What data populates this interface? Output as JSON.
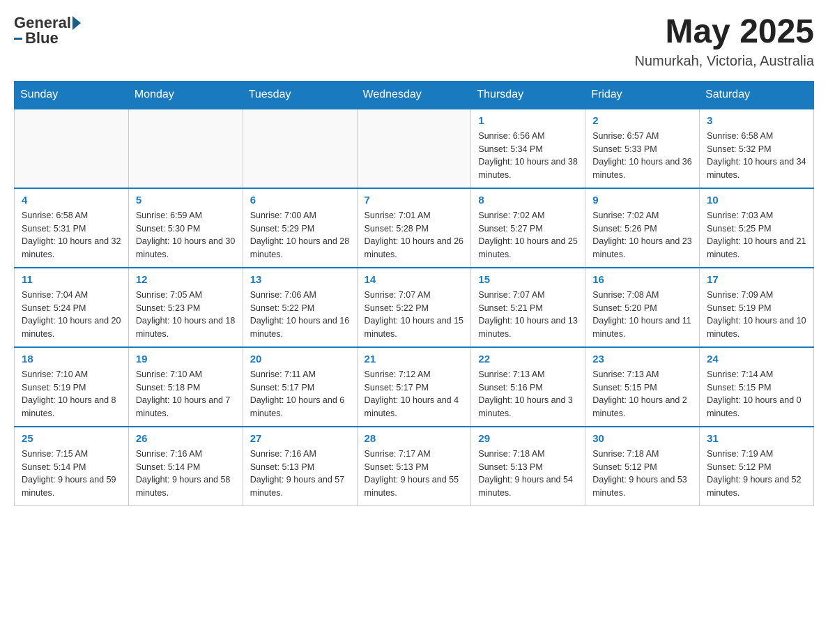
{
  "header": {
    "logo_general": "General",
    "logo_blue": "Blue",
    "month_title": "May 2025",
    "location": "Numurkah, Victoria, Australia"
  },
  "days_of_week": [
    "Sunday",
    "Monday",
    "Tuesday",
    "Wednesday",
    "Thursday",
    "Friday",
    "Saturday"
  ],
  "weeks": [
    [
      {
        "day": "",
        "info": ""
      },
      {
        "day": "",
        "info": ""
      },
      {
        "day": "",
        "info": ""
      },
      {
        "day": "",
        "info": ""
      },
      {
        "day": "1",
        "info": "Sunrise: 6:56 AM\nSunset: 5:34 PM\nDaylight: 10 hours and 38 minutes."
      },
      {
        "day": "2",
        "info": "Sunrise: 6:57 AM\nSunset: 5:33 PM\nDaylight: 10 hours and 36 minutes."
      },
      {
        "day": "3",
        "info": "Sunrise: 6:58 AM\nSunset: 5:32 PM\nDaylight: 10 hours and 34 minutes."
      }
    ],
    [
      {
        "day": "4",
        "info": "Sunrise: 6:58 AM\nSunset: 5:31 PM\nDaylight: 10 hours and 32 minutes."
      },
      {
        "day": "5",
        "info": "Sunrise: 6:59 AM\nSunset: 5:30 PM\nDaylight: 10 hours and 30 minutes."
      },
      {
        "day": "6",
        "info": "Sunrise: 7:00 AM\nSunset: 5:29 PM\nDaylight: 10 hours and 28 minutes."
      },
      {
        "day": "7",
        "info": "Sunrise: 7:01 AM\nSunset: 5:28 PM\nDaylight: 10 hours and 26 minutes."
      },
      {
        "day": "8",
        "info": "Sunrise: 7:02 AM\nSunset: 5:27 PM\nDaylight: 10 hours and 25 minutes."
      },
      {
        "day": "9",
        "info": "Sunrise: 7:02 AM\nSunset: 5:26 PM\nDaylight: 10 hours and 23 minutes."
      },
      {
        "day": "10",
        "info": "Sunrise: 7:03 AM\nSunset: 5:25 PM\nDaylight: 10 hours and 21 minutes."
      }
    ],
    [
      {
        "day": "11",
        "info": "Sunrise: 7:04 AM\nSunset: 5:24 PM\nDaylight: 10 hours and 20 minutes."
      },
      {
        "day": "12",
        "info": "Sunrise: 7:05 AM\nSunset: 5:23 PM\nDaylight: 10 hours and 18 minutes."
      },
      {
        "day": "13",
        "info": "Sunrise: 7:06 AM\nSunset: 5:22 PM\nDaylight: 10 hours and 16 minutes."
      },
      {
        "day": "14",
        "info": "Sunrise: 7:07 AM\nSunset: 5:22 PM\nDaylight: 10 hours and 15 minutes."
      },
      {
        "day": "15",
        "info": "Sunrise: 7:07 AM\nSunset: 5:21 PM\nDaylight: 10 hours and 13 minutes."
      },
      {
        "day": "16",
        "info": "Sunrise: 7:08 AM\nSunset: 5:20 PM\nDaylight: 10 hours and 11 minutes."
      },
      {
        "day": "17",
        "info": "Sunrise: 7:09 AM\nSunset: 5:19 PM\nDaylight: 10 hours and 10 minutes."
      }
    ],
    [
      {
        "day": "18",
        "info": "Sunrise: 7:10 AM\nSunset: 5:19 PM\nDaylight: 10 hours and 8 minutes."
      },
      {
        "day": "19",
        "info": "Sunrise: 7:10 AM\nSunset: 5:18 PM\nDaylight: 10 hours and 7 minutes."
      },
      {
        "day": "20",
        "info": "Sunrise: 7:11 AM\nSunset: 5:17 PM\nDaylight: 10 hours and 6 minutes."
      },
      {
        "day": "21",
        "info": "Sunrise: 7:12 AM\nSunset: 5:17 PM\nDaylight: 10 hours and 4 minutes."
      },
      {
        "day": "22",
        "info": "Sunrise: 7:13 AM\nSunset: 5:16 PM\nDaylight: 10 hours and 3 minutes."
      },
      {
        "day": "23",
        "info": "Sunrise: 7:13 AM\nSunset: 5:15 PM\nDaylight: 10 hours and 2 minutes."
      },
      {
        "day": "24",
        "info": "Sunrise: 7:14 AM\nSunset: 5:15 PM\nDaylight: 10 hours and 0 minutes."
      }
    ],
    [
      {
        "day": "25",
        "info": "Sunrise: 7:15 AM\nSunset: 5:14 PM\nDaylight: 9 hours and 59 minutes."
      },
      {
        "day": "26",
        "info": "Sunrise: 7:16 AM\nSunset: 5:14 PM\nDaylight: 9 hours and 58 minutes."
      },
      {
        "day": "27",
        "info": "Sunrise: 7:16 AM\nSunset: 5:13 PM\nDaylight: 9 hours and 57 minutes."
      },
      {
        "day": "28",
        "info": "Sunrise: 7:17 AM\nSunset: 5:13 PM\nDaylight: 9 hours and 55 minutes."
      },
      {
        "day": "29",
        "info": "Sunrise: 7:18 AM\nSunset: 5:13 PM\nDaylight: 9 hours and 54 minutes."
      },
      {
        "day": "30",
        "info": "Sunrise: 7:18 AM\nSunset: 5:12 PM\nDaylight: 9 hours and 53 minutes."
      },
      {
        "day": "31",
        "info": "Sunrise: 7:19 AM\nSunset: 5:12 PM\nDaylight: 9 hours and 52 minutes."
      }
    ]
  ]
}
